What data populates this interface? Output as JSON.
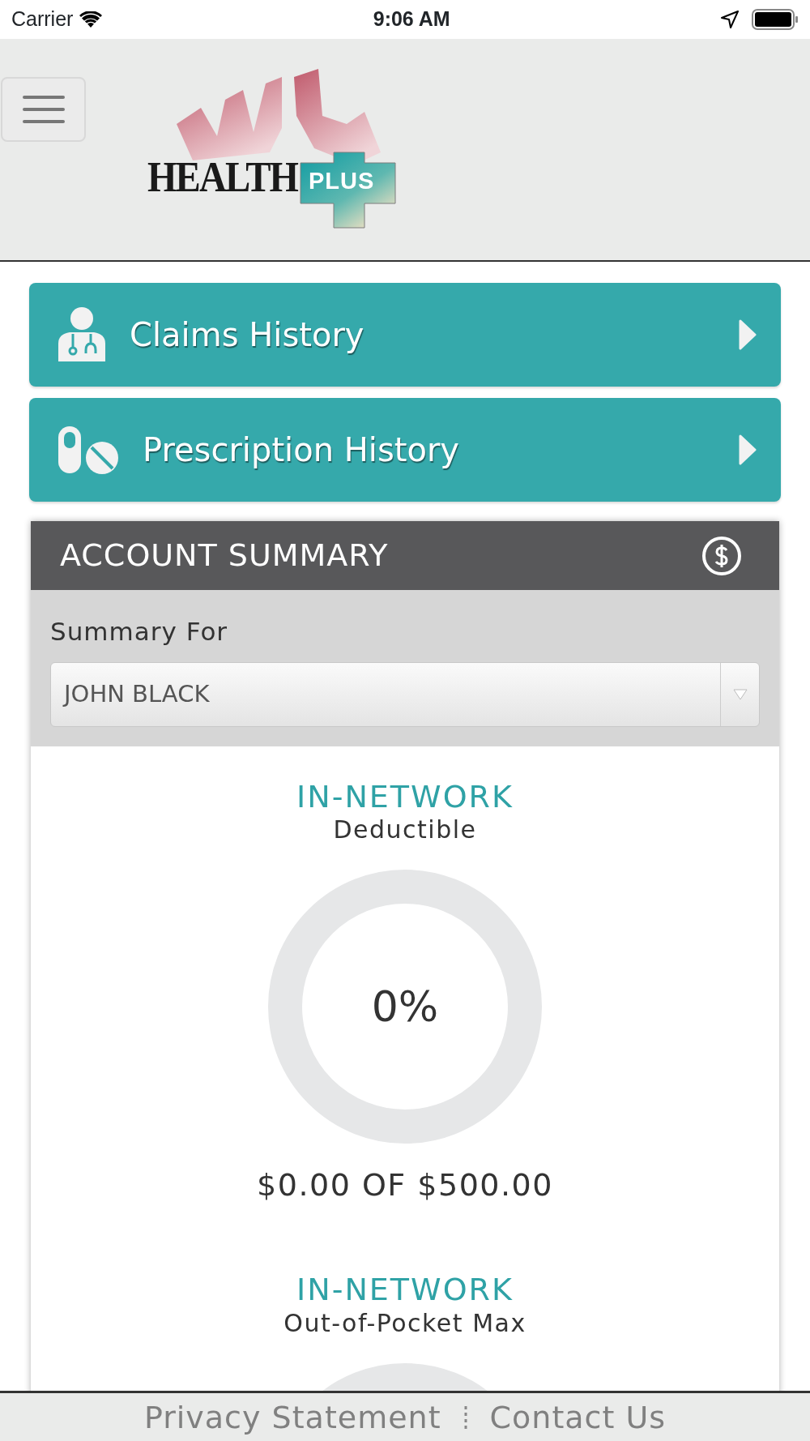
{
  "status_bar": {
    "carrier": "Carrier",
    "time": "9:06 AM"
  },
  "header": {
    "logo": {
      "word": "HEALTH",
      "badge": "PLUS"
    }
  },
  "nav_buttons": [
    {
      "kind": "doctor",
      "label": "Claims History"
    },
    {
      "kind": "pills",
      "label": "Prescription History"
    }
  ],
  "account_summary": {
    "title": "ACCOUNT SUMMARY",
    "filter_label": "Summary For",
    "member_select": {
      "value": "JOHN BLACK"
    },
    "meters": [
      {
        "category": "IN-NETWORK",
        "label": "Deductible",
        "percent": "0%",
        "level": 0,
        "amount": "$0.00 OF $500.00"
      },
      {
        "category": "IN-NETWORK",
        "label": "Out-of-Pocket Max"
      }
    ]
  },
  "footer": {
    "links": [
      "Privacy Statement",
      "Contact Us"
    ]
  }
}
